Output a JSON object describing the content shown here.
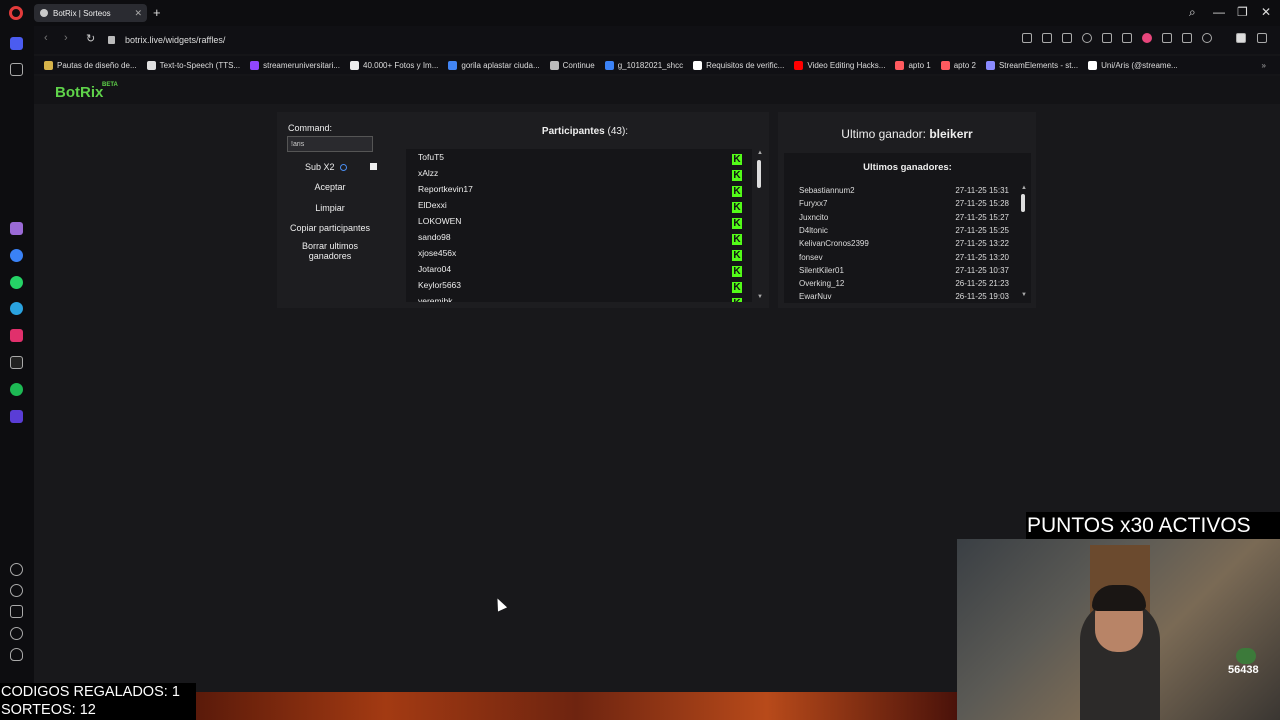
{
  "browser": {
    "tab_title": "BotRix | Sorteos",
    "new_tab_label": "+",
    "url": "botrix.live/widgets/raffles/",
    "window_controls": {
      "search": "⌕",
      "minimize": "—",
      "restore": "❐",
      "close": "✕"
    },
    "bookmarks": [
      {
        "label": "Pautas de diseño de...",
        "icon": "bookmark-icon",
        "color": "#d6b34a"
      },
      {
        "label": "Text-to-Speech (TTS...",
        "icon": "tts-icon",
        "color": "#e0e0e0"
      },
      {
        "label": "streameruniversitari...",
        "icon": "twitch-icon",
        "color": "#9146ff"
      },
      {
        "label": "40.000+ Fotos y Im...",
        "icon": "pexels-icon",
        "color": "#eeeeee"
      },
      {
        "label": "gorila aplastar ciuda...",
        "icon": "google-icon",
        "color": "#4285f4"
      },
      {
        "label": "Continue",
        "icon": "page-icon",
        "color": "#bbbbbb"
      },
      {
        "label": "g_10182021_shcc",
        "icon": "cloud-icon",
        "color": "#3b82f6"
      },
      {
        "label": "Requisitos de verific...",
        "icon": "x-icon",
        "color": "#ffffff"
      },
      {
        "label": "Video Editing Hacks...",
        "icon": "youtube-icon",
        "color": "#ff0000"
      },
      {
        "label": "apto 1",
        "icon": "airbnb-icon",
        "color": "#ff5a5f"
      },
      {
        "label": "apto 2",
        "icon": "airbnb-icon",
        "color": "#ff5a5f"
      },
      {
        "label": "StreamElements - st...",
        "icon": "streamelements-icon",
        "color": "#8a8aff"
      },
      {
        "label": "Uni/Aris (@streame...",
        "icon": "tiktok-icon",
        "color": "#ffffff"
      }
    ]
  },
  "sidebar": {
    "icons": [
      "home-icon",
      "star-icon",
      "aria-icon",
      "messenger-icon",
      "whatsapp-icon",
      "telegram-icon",
      "instagram-icon",
      "x-icon",
      "spotify-icon",
      "player-icon",
      "heart-icon",
      "history-icon",
      "box-icon",
      "settings-icon",
      "bulb-icon"
    ]
  },
  "botrix": {
    "logo": "BotRix",
    "beta": "BETA"
  },
  "raffle": {
    "command_label": "Command:",
    "command_value": "!aris",
    "sub_label": "Sub X2",
    "accept": "Aceptar",
    "clear": "Limpiar",
    "copy": "Copiar participantes",
    "delete_winners": "Borrar ultimos ganadores",
    "participants_title": "Participantes",
    "participants_count": "(43):",
    "participants": [
      "TofuT5",
      "xAlzz",
      "Reportkevin17",
      "ElDexxi",
      "LOKOWEN",
      "sando98",
      "xjose456x",
      "Jotaro04",
      "Keylor5663",
      "yeremibk"
    ],
    "platform_badge": "K",
    "last_winner_label": "Ultimo ganador:",
    "last_winner": "bleikerr",
    "winners_title": "Ultimos ganadores:",
    "winners": [
      {
        "name": "Sebastiannum2",
        "date": "27-11-25 15:31"
      },
      {
        "name": "Furyxx7",
        "date": "27-11-25 15:28"
      },
      {
        "name": "Juxncito",
        "date": "27-11-25 15:27"
      },
      {
        "name": "D4ltonic",
        "date": "27-11-25 15:25"
      },
      {
        "name": "KelivanCronos2399",
        "date": "27-11-25 13:22"
      },
      {
        "name": "fonsev",
        "date": "27-11-25 13:20"
      },
      {
        "name": "SilentKiler01",
        "date": "27-11-25 10:37"
      },
      {
        "name": "Overking_12",
        "date": "26-11-25 21:23"
      },
      {
        "name": "EwarNuv",
        "date": "26-11-25 19:03"
      }
    ]
  },
  "overlay": {
    "puntos": "PUNTOS x30 ACTIVOS",
    "counter": "56438",
    "codes": "CODIGOS REGALADOS: 1",
    "sorteos": "SORTEOS: 12"
  }
}
